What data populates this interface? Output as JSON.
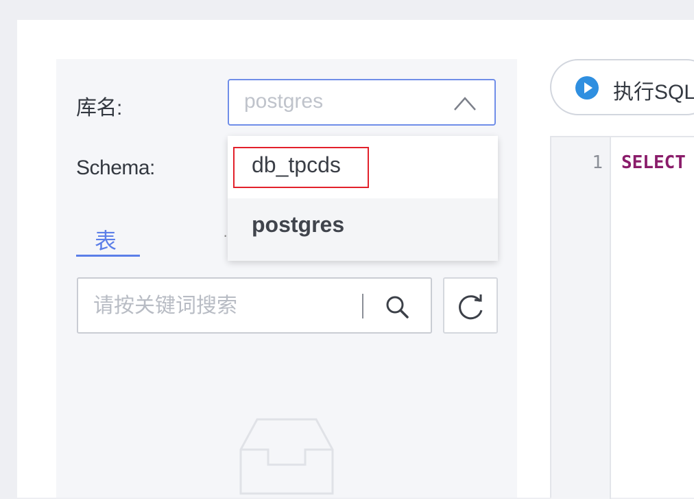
{
  "form": {
    "db_label": "库名:",
    "db_selected": "postgres",
    "schema_label": "Schema:"
  },
  "db_dropdown": {
    "options": [
      "db_tpcds",
      "postgres"
    ],
    "highlighted_option": "db_tpcds",
    "highlight_color": "#e2202a"
  },
  "tabs": {
    "active_label": "表",
    "partial_label": "·"
  },
  "search": {
    "placeholder": "请按关键词搜索"
  },
  "toolbar": {
    "run_label": "执行SQL"
  },
  "editor": {
    "line_number": "1",
    "code_text": "SELECT",
    "keyword_color": "#8a1c6a"
  },
  "icons": {
    "play": "play-circle-icon",
    "search": "search-icon",
    "refresh": "refresh-icon",
    "chevron": "chevron-up-icon",
    "empty": "empty-inbox-icon"
  },
  "colors": {
    "accent": "#5b7ee8",
    "play_icon": "#2f8fe0"
  }
}
